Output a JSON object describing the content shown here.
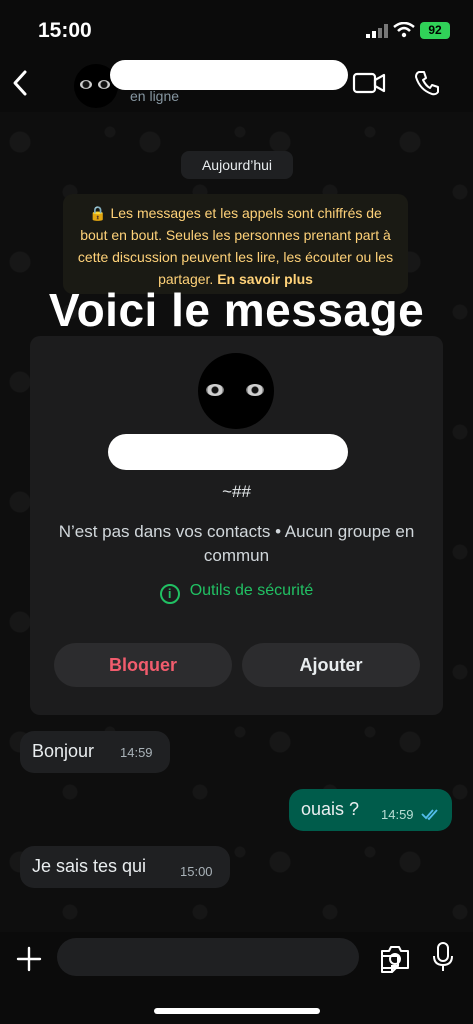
{
  "status_bar": {
    "time": "15:00",
    "battery": "92"
  },
  "header": {
    "subtitle": "en ligne"
  },
  "date_chip": "Aujourd’hui",
  "encryption": {
    "text": "Les messages et les appels sont chiffrés de bout en bout. Seules les personnes prenant part à cette discussion peuvent les lire, les écouter ou les partager.",
    "link": "En savoir plus"
  },
  "overlay_title": "Voici le message",
  "contact_card": {
    "handle": "~##",
    "meta": "N’est pas dans vos contacts • Aucun groupe en commun",
    "security_label": "Outils de sécurité",
    "block_label": "Bloquer",
    "add_label": "Ajouter"
  },
  "messages": [
    {
      "text": "Bonjour",
      "time": "14:59"
    },
    {
      "text": "ouais ?",
      "time": "14:59"
    },
    {
      "text": "Je sais tes qui",
      "time": "15:00"
    }
  ],
  "colors": {
    "outgoing_bubble": "#005c4b",
    "accent_green": "#21c063",
    "block_red": "#f15c6d"
  }
}
